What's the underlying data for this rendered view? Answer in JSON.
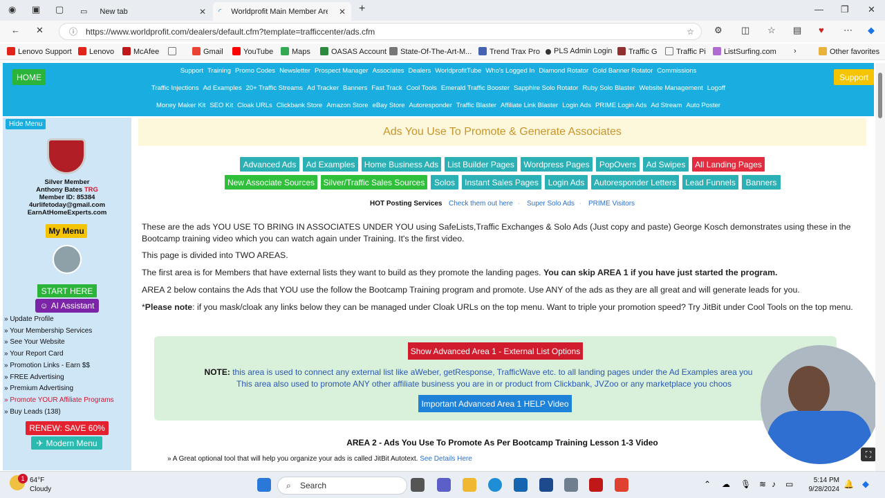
{
  "browser": {
    "tabs": [
      {
        "label": "New tab"
      },
      {
        "label": "Worldprofit Main Member Area fo"
      }
    ],
    "url": "https://www.worldprofit.com/dealers/default.cfm?template=trafficcenter/ads.cfm",
    "bookmarks": [
      "Lenovo Support",
      "Lenovo",
      "McAfee",
      "Gmail",
      "YouTube",
      "Maps",
      "OASAS Account",
      "State-Of-The-Art-M...",
      "Trend Trax Pro",
      "PLS Admin Login",
      "Traffic G",
      "Traffic Pi",
      "ListSurfing.com",
      "Other favorites"
    ]
  },
  "nav": {
    "home": "HOME",
    "support": "Support",
    "row1": [
      "Support",
      "Training",
      "Promo Codes",
      "Newsletter",
      "Prospect Manager",
      "Associates",
      "Dealers",
      "WorldprofitTube",
      "Who's Logged In",
      "Diamond Rotator",
      "Gold Banner Rotator",
      "Commissions"
    ],
    "row2": [
      "Traffic Injections",
      "Ad Examples",
      "20+ Traffic Streams",
      "Ad Tracker",
      "Banners",
      "Fast Track",
      "Cool Tools",
      "Emerald Traffic Booster",
      "Sapphire Solo Rotator",
      "Ruby Solo Blaster",
      "Website Management",
      "Logoff"
    ],
    "row3": [
      "Money Maker Kit",
      "SEO Kit",
      "Cloak URLs",
      "Clickbank Store",
      "Amazon Store",
      "eBay Store",
      "Autoresponder",
      "Traffic Blaster",
      "Affiliate Link Blaster",
      "Login Ads",
      "PRIME Login Ads",
      "Ad Stream",
      "Auto Poster"
    ]
  },
  "sidebar": {
    "hide_menu": "Hide Menu",
    "badge_text": "Worldprofit Silver Member",
    "level": "Silver Member",
    "name": "Anthony Bates",
    "name_tag": "TRG",
    "member_id": "Member ID: 85384",
    "email": "4urlifetoday@gmail.com",
    "site": "EarnAtHomeExperts.com",
    "my_menu": "My Menu",
    "start_here": "START HERE",
    "ai_assistant": "AI Assistant",
    "links": [
      "» Update Profile",
      "» Your Membership Services",
      "» See Your Website",
      "» Your Report Card",
      "» Promotion Links - Earn $$",
      "» FREE Advertising",
      "» Premium Advertising",
      "» Promote YOUR Affiliate Programs",
      "» Buy Leads (138)"
    ],
    "renew": "RENEW: SAVE 60%",
    "modern_menu": "Modern Menu"
  },
  "main": {
    "title": "Ads You Use To Promote & Generate Associates",
    "cats_row1": [
      "Advanced Ads",
      "Ad Examples",
      "Home Business Ads",
      "List Builder Pages",
      "Wordpress Pages",
      "PopOvers",
      "Ad Swipes",
      "All Landing Pages"
    ],
    "cats_row2": [
      "New Associate Sources",
      "Silver/Traffic Sales Sources",
      "Solos",
      "Instant Sales Pages",
      "Login Ads",
      "Autoresponder Letters",
      "Lead Funnels",
      "Banners"
    ],
    "hot_label": "HOT Posting Services",
    "hot_links": [
      "Check them out here",
      "Super Solo Ads",
      "PRIME Visitors"
    ],
    "para1": "These are the ads YOU USE TO BRING IN ASSOCIATES UNDER YOU using SafeLists,Traffic Exchanges & Solo Ads (Just copy and paste) George Kosch demonstrates using these in the Bootcamp training video which you can watch again under Training. It's the first video.",
    "para2": "This page is divided into TWO AREAS.",
    "para3a": "The first area is for Members that have external lists they want to build as they promote the landing pages. ",
    "para3b": "You can skip AREA 1 if you have just started the program.",
    "para4": "AREA 2 below contains the Ads that YOU use the follow the Bootcamp Training program and promote. Use ANY of the ads as they are all great and will generate leads for you.",
    "para5a": "*",
    "para5b": "Please note",
    "para5c": ": if you mask/cloak any links below they can be managed under Cloak URLs on the top menu. Want to triple your promotion speed? Try JitBit under Cool Tools on the top menu.",
    "adv_button": "Show Advanced Area 1 - External List Options",
    "note_label": "NOTE:",
    "note1": " this area is used to connect any external list like aWeber, getResponse, TrafficWave etc. to all landing pages under the Ad Examples area you",
    "note2": "This area also used to promote ANY other affiliate business you are in or product from Clickbank, JVZoo or any marketplace you choos",
    "help_button": "Important Advanced Area 1 HELP Video",
    "area2_title": "AREA 2 - Ads You Use To Promote As Per Bootcamp Training Lesson 1-3 Video",
    "hint": "» A Great optional tool that will help you organize your ads is called JitBit Autotext.",
    "hint_link": "See Details Here"
  },
  "taskbar": {
    "temp": "64°F",
    "weather": "Cloudy",
    "search": "Search",
    "time": "5:14 PM",
    "date": "9/28/2024",
    "badge": "1"
  },
  "colors": {
    "nav": "#1aaee0",
    "sidebar": "#cfe6f7",
    "header_text": "#c8942a",
    "teal": "#2ab0b5",
    "green": "#2fbf3b",
    "red": "#e12d3f"
  }
}
